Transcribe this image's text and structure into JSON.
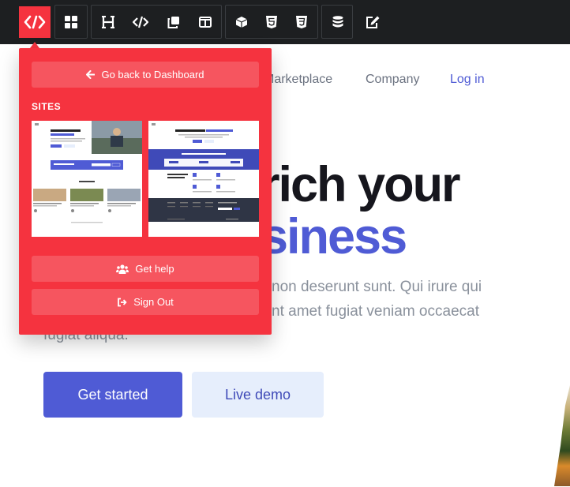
{
  "toolbar": {
    "logo_icon": "code-brackets-logo-icon",
    "buttons": [
      {
        "icon": "layout-grid-icon"
      },
      {
        "icon": "heading-icon"
      },
      {
        "icon": "code-icon"
      },
      {
        "icon": "copy-icon"
      },
      {
        "icon": "columns-icon"
      },
      {
        "icon": "box-icon"
      },
      {
        "icon": "html5-icon"
      },
      {
        "icon": "css3-icon"
      },
      {
        "icon": "database-icon"
      },
      {
        "icon": "edit-icon"
      }
    ]
  },
  "page": {
    "nav": {
      "marketplace": "Marketplace",
      "company": "Company",
      "login": "Log in"
    },
    "hero": {
      "line1_visible": "rich your",
      "line2_visible": "siness"
    },
    "body_lines": [
      "non deserunt sunt. Qui irure qui",
      "nt amet fugiat veniam occaecat",
      "fugiat aliqua."
    ],
    "cta_primary": "Get started",
    "cta_secondary": "Live demo"
  },
  "dropdown": {
    "back_label": "Go back to Dashboard",
    "sites_heading": "SITES",
    "help_label": "Get help",
    "signout_label": "Sign Out"
  },
  "colors": {
    "accent_red": "#f5333f",
    "brand_indigo": "#4f5bd5",
    "toolbar_bg": "#1d1f21"
  }
}
